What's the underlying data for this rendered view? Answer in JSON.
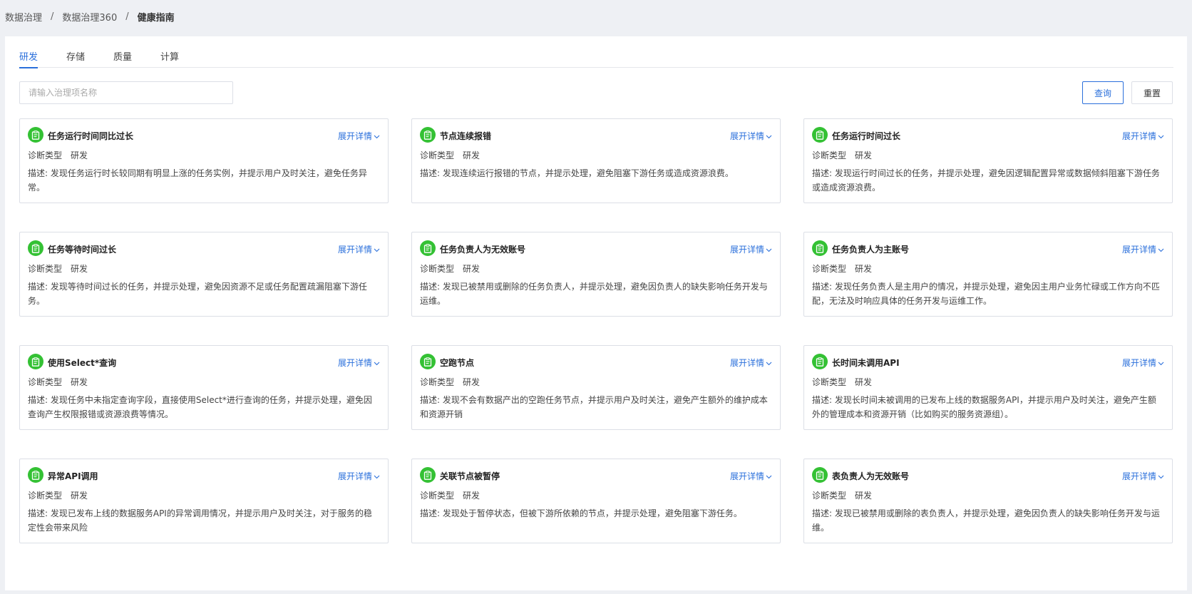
{
  "breadcrumb": [
    "数据治理",
    "数据治理360",
    "健康指南"
  ],
  "tabs": [
    "研发",
    "存储",
    "质量",
    "计算"
  ],
  "search": {
    "placeholder": "请输入治理项名称"
  },
  "buttons": {
    "query": "查询",
    "reset": "重置"
  },
  "expand_label": "展开详情",
  "cards": [
    {
      "title": "任务运行时间同比过长",
      "type_label": "诊断类型",
      "type_value": "研发",
      "desc": "描述: 发现任务运行时长较同期有明显上涨的任务实例，并提示用户及时关注，避免任务异常。"
    },
    {
      "title": "节点连续报错",
      "type_label": "诊断类型",
      "type_value": "研发",
      "desc": "描述: 发现连续运行报错的节点，并提示处理，避免阻塞下游任务或造成资源浪费。"
    },
    {
      "title": "任务运行时间过长",
      "type_label": "诊断类型",
      "type_value": "研发",
      "desc": "描述: 发现运行时间过长的任务，并提示处理，避免因逻辑配置异常或数据倾斜阻塞下游任务或造成资源浪费。"
    },
    {
      "title": "任务等待时间过长",
      "type_label": "诊断类型",
      "type_value": "研发",
      "desc": "描述: 发现等待时间过长的任务，并提示处理，避免因资源不足或任务配置疏漏阻塞下游任务。"
    },
    {
      "title": "任务负责人为无效账号",
      "type_label": "诊断类型",
      "type_value": "研发",
      "desc": "描述: 发现已被禁用或删除的任务负责人，并提示处理，避免因负责人的缺失影响任务开发与运维。"
    },
    {
      "title": "任务负责人为主账号",
      "type_label": "诊断类型",
      "type_value": "研发",
      "desc": "描述: 发现任务负责人是主用户的情况，并提示处理，避免因主用户业务忙碌或工作方向不匹配，无法及时响应具体的任务开发与运维工作。"
    },
    {
      "title": "使用Select*查询",
      "type_label": "诊断类型",
      "type_value": "研发",
      "desc": "描述: 发现任务中未指定查询字段，直接使用Select*进行查询的任务，并提示处理，避免因查询产生权限报错或资源浪费等情况。"
    },
    {
      "title": "空跑节点",
      "type_label": "诊断类型",
      "type_value": "研发",
      "desc": "描述: 发现不会有数据产出的空跑任务节点，并提示用户及时关注，避免产生额外的维护成本和资源开销"
    },
    {
      "title": "长时间未调用API",
      "type_label": "诊断类型",
      "type_value": "研发",
      "desc": "描述: 发现长时间未被调用的已发布上线的数据服务API，并提示用户及时关注，避免产生额外的管理成本和资源开销（比如购买的服务资源组）。"
    },
    {
      "title": "异常API调用",
      "type_label": "诊断类型",
      "type_value": "研发",
      "desc": "描述: 发现已发布上线的数据服务API的异常调用情况，并提示用户及时关注，对于服务的稳定性会带来风险"
    },
    {
      "title": "关联节点被暂停",
      "type_label": "诊断类型",
      "type_value": "研发",
      "desc": "描述: 发现处于暂停状态，但被下游所依赖的节点，并提示处理，避免阻塞下游任务。"
    },
    {
      "title": "表负责人为无效账号",
      "type_label": "诊断类型",
      "type_value": "研发",
      "desc": "描述: 发现已被禁用或删除的表负责人，并提示处理，避免因负责人的缺失影响任务开发与运维。"
    }
  ],
  "colors": {
    "accent": "#2a6fdb",
    "icon_bg": "#34c134"
  }
}
